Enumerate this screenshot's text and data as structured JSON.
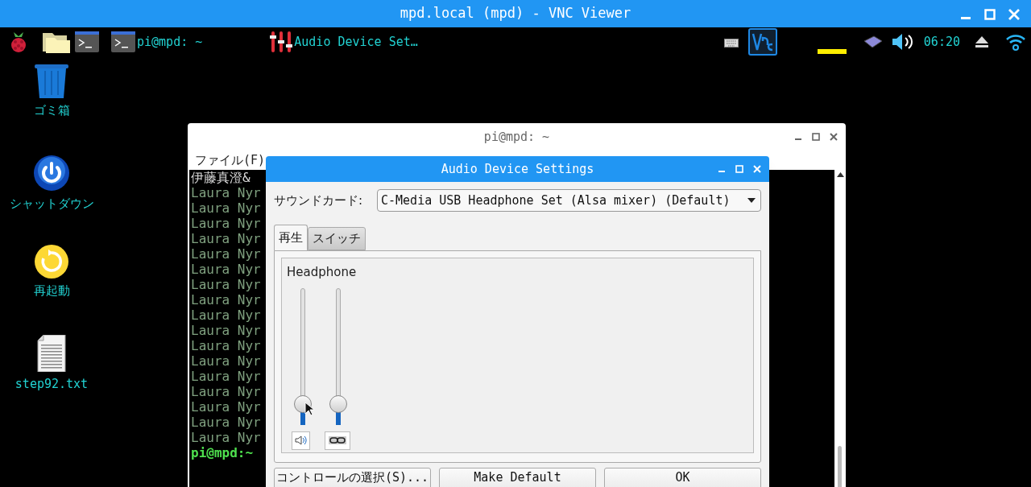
{
  "vnc_window": {
    "title": "mpd.local (mpd) - VNC Viewer"
  },
  "taskbar": {
    "tasks": [
      {
        "kind": "terminal",
        "label": "pi@mpd: ~"
      },
      {
        "kind": "mixer",
        "label": "Audio Device Set…"
      }
    ],
    "clock": "06:20"
  },
  "desktop_icons": [
    {
      "kind": "trash",
      "label": "ゴミ箱"
    },
    {
      "kind": "shutdown",
      "label": "シャットダウン"
    },
    {
      "kind": "reboot",
      "label": "再起動"
    },
    {
      "kind": "file",
      "label": "step92.txt"
    }
  ],
  "terminal": {
    "title": "pi@mpd: ~",
    "menu": [
      "ファイル(F)"
    ],
    "lines": [
      {
        "kind": "plain",
        "text": "伊藤真澄&"
      },
      {
        "kind": "output",
        "text": "Laura Nyr"
      },
      {
        "kind": "output",
        "text": "Laura Nyr"
      },
      {
        "kind": "output",
        "text": "Laura Nyr"
      },
      {
        "kind": "output",
        "text": "Laura Nyr"
      },
      {
        "kind": "output",
        "text": "Laura Nyr"
      },
      {
        "kind": "output",
        "text": "Laura Nyr"
      },
      {
        "kind": "output",
        "text": "Laura Nyr"
      },
      {
        "kind": "output",
        "text": "Laura Nyr"
      },
      {
        "kind": "output",
        "text": "Laura Nyr"
      },
      {
        "kind": "output",
        "text": "Laura Nyr"
      },
      {
        "kind": "output",
        "text": "Laura Nyr"
      },
      {
        "kind": "output",
        "text": "Laura Nyr"
      },
      {
        "kind": "output",
        "text": "Laura Nyr"
      },
      {
        "kind": "output",
        "text": "Laura Nyr"
      },
      {
        "kind": "output",
        "text": "Laura Nyr"
      },
      {
        "kind": "output",
        "text": "Laura Nyr"
      },
      {
        "kind": "output",
        "text": "Laura Nyr"
      },
      {
        "kind": "prompt",
        "text": "pi@mpd:~"
      }
    ]
  },
  "dialog": {
    "title": "Audio Device Settings",
    "sound_card_label": "サウンドカード:",
    "sound_card": "C-Media USB Headphone Set (Alsa mixer) (Default)",
    "tabs": [
      {
        "label": "再生",
        "selected": true
      },
      {
        "label": "スイッチ",
        "selected": false
      }
    ],
    "control": {
      "name": "Headphone",
      "channels": [
        {
          "level": 0.1
        },
        {
          "level": 0.1
        }
      ]
    },
    "buttons": [
      "コントロールの選択(S)...",
      "Make Default",
      "OK"
    ]
  }
}
